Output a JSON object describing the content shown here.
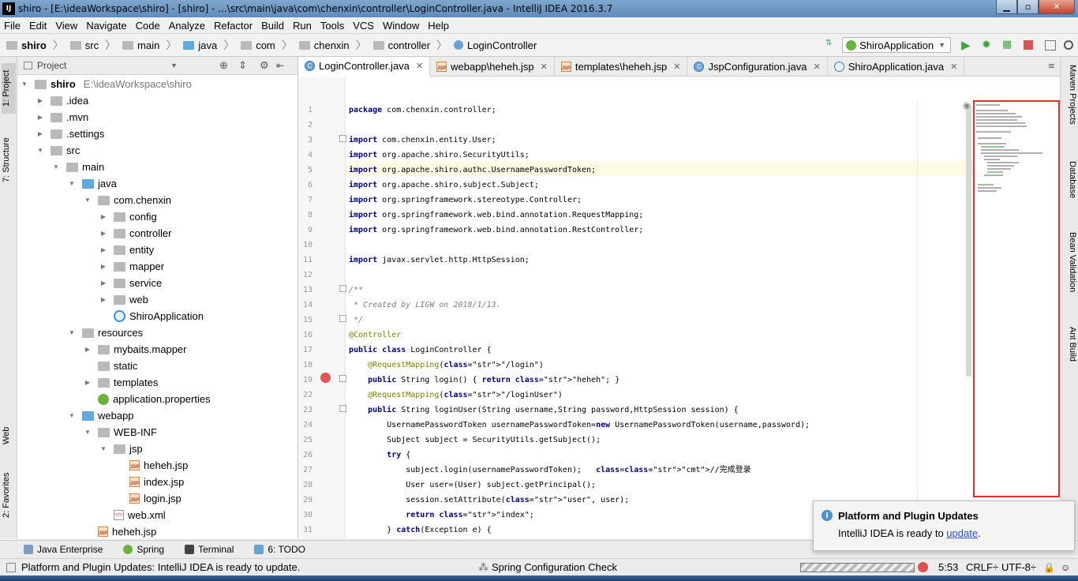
{
  "window": {
    "title": "shiro - [E:\\ideaWorkspace\\shiro] - [shiro] - ...\\src\\main\\java\\com\\chenxin\\controller\\LoginController.java - IntelliJ IDEA 2016.3.7",
    "icon": "IJ"
  },
  "menu": [
    "File",
    "Edit",
    "View",
    "Navigate",
    "Code",
    "Analyze",
    "Refactor",
    "Build",
    "Run",
    "Tools",
    "VCS",
    "Window",
    "Help"
  ],
  "breadcrumbs": [
    "shiro",
    "src",
    "main",
    "java",
    "com",
    "chenxin",
    "controller",
    "LoginController"
  ],
  "run_config": "ShiroApplication",
  "left_tabs": {
    "project": "1: Project",
    "structure": "7: Structure",
    "web": "Web",
    "favorites": "2: Favorites"
  },
  "right_tabs": {
    "maven": "Maven Projects",
    "database": "Database",
    "bean": "Bean Validation",
    "ant": "Ant Build"
  },
  "project_panel": {
    "title": "Project",
    "tree": [
      {
        "label": "shiro",
        "extra": "E:\\ideaWorkspace\\shiro"
      },
      {
        "label": ".idea"
      },
      {
        "label": ".mvn"
      },
      {
        "label": ".settings"
      },
      {
        "label": "src"
      },
      {
        "label": "main"
      },
      {
        "label": "java"
      },
      {
        "label": "com.chenxin"
      },
      {
        "label": "config"
      },
      {
        "label": "controller"
      },
      {
        "label": "entity"
      },
      {
        "label": "mapper"
      },
      {
        "label": "service"
      },
      {
        "label": "web"
      },
      {
        "label": "ShiroApplication"
      },
      {
        "label": "resources"
      },
      {
        "label": "mybaits.mapper"
      },
      {
        "label": "static"
      },
      {
        "label": "templates"
      },
      {
        "label": "application.properties"
      },
      {
        "label": "webapp"
      },
      {
        "label": "WEB-INF"
      },
      {
        "label": "jsp"
      },
      {
        "label": "heheh.jsp"
      },
      {
        "label": "index.jsp"
      },
      {
        "label": "login.jsp"
      },
      {
        "label": "web.xml"
      },
      {
        "label": "heheh.jsp"
      }
    ]
  },
  "editor_tabs": [
    {
      "label": "LoginController.java",
      "active": true
    },
    {
      "label": "webapp\\heheh.jsp"
    },
    {
      "label": "templates\\heheh.jsp"
    },
    {
      "label": "JspConfiguration.java"
    },
    {
      "label": "ShiroApplication.java"
    }
  ],
  "code_lines": [
    {
      "n": "1",
      "t": "package com.chenxin.controller;"
    },
    {
      "n": "2",
      "t": ""
    },
    {
      "n": "3",
      "t": "import com.chenxin.entity.User;"
    },
    {
      "n": "4",
      "t": "import org.apache.shiro.SecurityUtils;"
    },
    {
      "n": "5",
      "t": "import org.apache.shiro.authc.UsernamePasswordToken;"
    },
    {
      "n": "6",
      "t": "import org.apache.shiro.subject.Subject;"
    },
    {
      "n": "7",
      "t": "import org.springframework.stereotype.Controller;"
    },
    {
      "n": "8",
      "t": "import org.springframework.web.bind.annotation.RequestMapping;"
    },
    {
      "n": "9",
      "t": "import org.springframework.web.bind.annotation.RestController;"
    },
    {
      "n": "10",
      "t": ""
    },
    {
      "n": "11",
      "t": "import javax.servlet.http.HttpSession;"
    },
    {
      "n": "12",
      "t": ""
    },
    {
      "n": "13",
      "t": "/**"
    },
    {
      "n": "14",
      "t": " * Created by LIGW on 2018/1/13."
    },
    {
      "n": "15",
      "t": " */"
    },
    {
      "n": "16",
      "t": "@Controller"
    },
    {
      "n": "17",
      "t": "public class LoginController {"
    },
    {
      "n": "18",
      "t": "    @RequestMapping(\"/login\")"
    },
    {
      "n": "19",
      "t": "    public String login() { return \"heheh\"; }"
    },
    {
      "n": "22",
      "t": "    @RequestMapping(\"/loginUser\")"
    },
    {
      "n": "23",
      "t": "    public String loginUser(String username,String password,HttpSession session) {"
    },
    {
      "n": "24",
      "t": "        UsernamePasswordToken usernamePasswordToken=new UsernamePasswordToken(username,password);"
    },
    {
      "n": "25",
      "t": "        Subject subject = SecurityUtils.getSubject();"
    },
    {
      "n": "26",
      "t": "        try {"
    },
    {
      "n": "27",
      "t": "            subject.login(usernamePasswordToken);   //完成登录"
    },
    {
      "n": "28",
      "t": "            User user=(User) subject.getPrincipal();"
    },
    {
      "n": "29",
      "t": "            session.setAttribute(\"user\", user);"
    },
    {
      "n": "30",
      "t": "            return \"index\";"
    },
    {
      "n": "31",
      "t": "        } catch(Exception e) {"
    }
  ],
  "bottom_tools": [
    "Java Enterprise",
    "Spring",
    "Terminal",
    "6: TODO"
  ],
  "status": {
    "message": "Platform and Plugin Updates: IntelliJ IDEA is ready to update.",
    "task": "Spring Configuration Check",
    "position": "5:53",
    "line_sep": "CRLF÷",
    "encoding": "UTF-8÷"
  },
  "notification": {
    "title": "Platform and Plugin Updates",
    "body": "IntelliJ IDEA is ready to",
    "link": "update",
    "suffix": "."
  },
  "colors": {
    "accent": "#3b8fd0",
    "highlight_box": "#e03030",
    "keyword": "#000080",
    "string": "#008000"
  }
}
